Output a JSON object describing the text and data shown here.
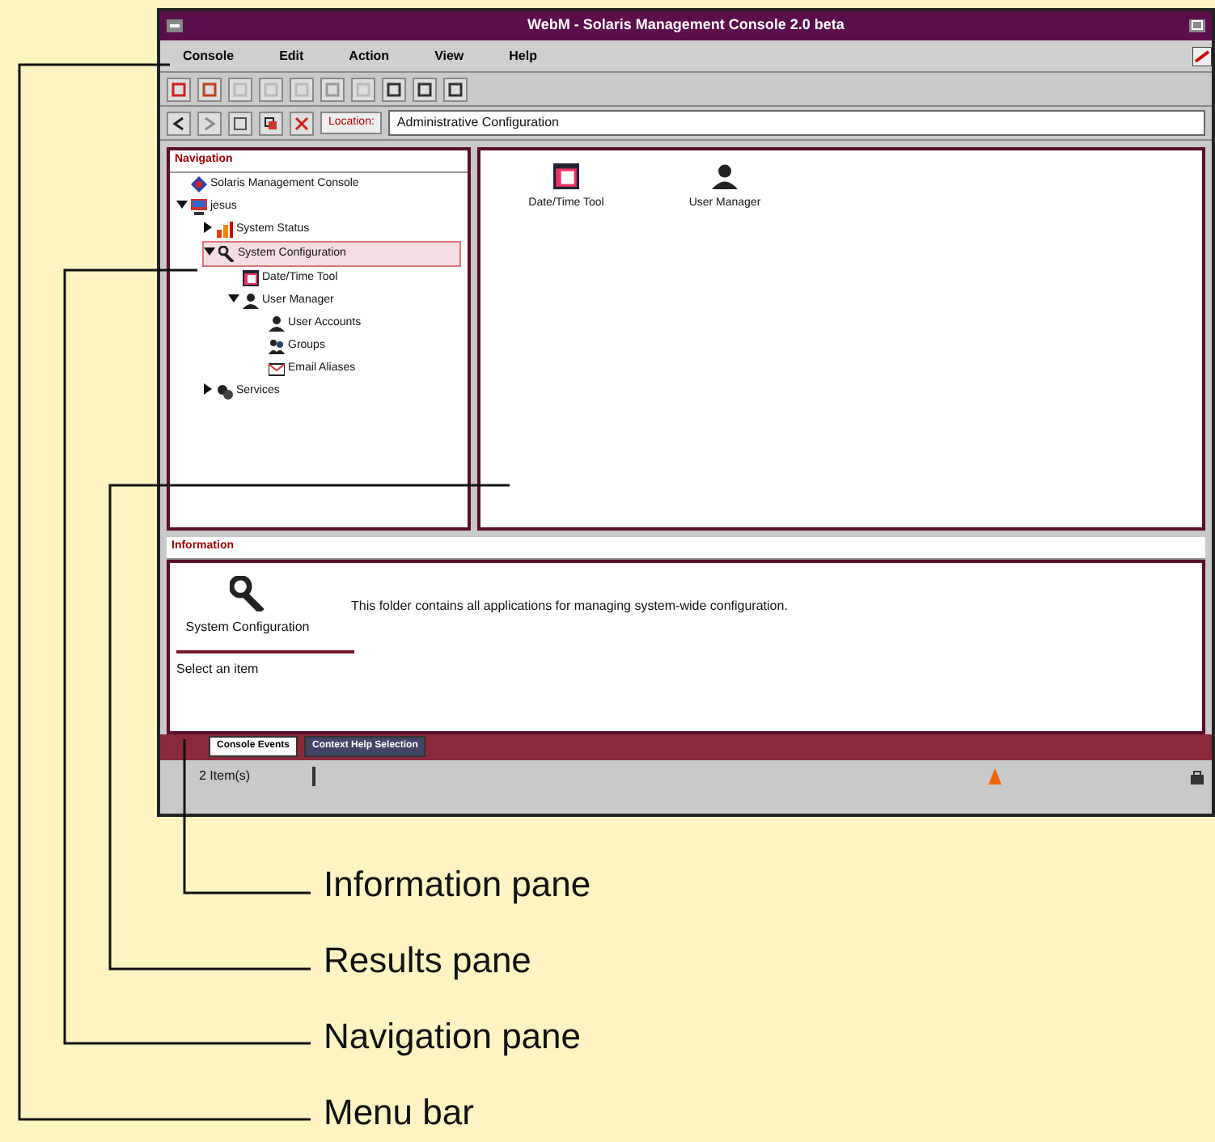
{
  "window": {
    "title": "WebM - Solaris Management Console 2.0 beta"
  },
  "menu_bar": [
    "Console",
    "Edit",
    "Action",
    "View",
    "Help"
  ],
  "location": {
    "label": "Location:",
    "value": "Administrative Configuration"
  },
  "navigation": {
    "header": "Navigation",
    "tree": [
      {
        "label": "Solaris Management Console",
        "selected": false
      },
      {
        "label": "jesus",
        "expanded": true,
        "selected": false,
        "children": [
          {
            "label": "System Status",
            "expanded": false,
            "selected": false
          },
          {
            "label": "System Configuration",
            "expanded": true,
            "selected": true,
            "children": [
              {
                "label": "Date/Time Tool",
                "selected": false
              },
              {
                "label": "User Manager",
                "expanded": true,
                "selected": false,
                "children": [
                  {
                    "label": "User Accounts",
                    "selected": false
                  },
                  {
                    "label": "Groups",
                    "selected": false
                  },
                  {
                    "label": "Email Aliases",
                    "selected": false
                  }
                ]
              }
            ]
          },
          {
            "label": "Services",
            "expanded": false,
            "selected": false
          }
        ]
      }
    ]
  },
  "results": [
    {
      "label": "Date/Time Tool"
    },
    {
      "label": "User Manager"
    }
  ],
  "information": {
    "header": "Information",
    "icon_label": "System Configuration",
    "text": "This folder contains all applications for managing system-wide configuration.",
    "hint": "Select an item"
  },
  "bottom_tabs": [
    {
      "label": "Console Events",
      "selected": true
    },
    {
      "label": "Context Help Selection",
      "selected": false
    }
  ],
  "status_bar": {
    "text": "2 Item(s)"
  },
  "callouts": [
    "Information pane",
    "Results pane",
    "Navigation pane",
    "Menu bar"
  ]
}
